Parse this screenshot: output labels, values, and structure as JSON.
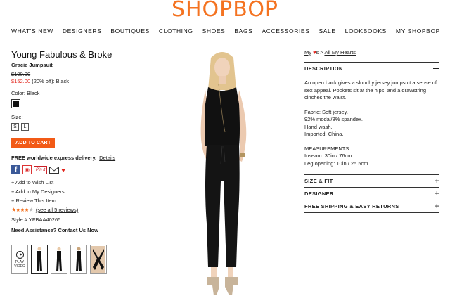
{
  "site": {
    "logo": "SHOPBOP"
  },
  "nav": [
    "WHAT'S NEW",
    "DESIGNERS",
    "BOUTIQUES",
    "CLOTHING",
    "SHOES",
    "BAGS",
    "ACCESSORIES",
    "SALE",
    "LOOKBOOKS",
    "MY SHOPBOP"
  ],
  "product": {
    "brand": "Young Fabulous & Broke",
    "name": "Gracie Jumpsuit",
    "original_price": "$190.00",
    "sale_price": "$152.00",
    "discount_text": "(20% off): Black",
    "color_label": "Color: Black",
    "swatch_color": "#111111",
    "size_label": "Size:",
    "sizes": [
      "S",
      "L"
    ],
    "add_to_cart": "ADD TO CART",
    "delivery_text": "FREE worldwide express delivery.",
    "delivery_link": "Details",
    "wish_list": "+ Add to Wish List",
    "my_designers": "+ Add to My Designers",
    "review": "+ Review This Item",
    "rating": 4,
    "rating_max": 5,
    "reviews_link": "(see all 5 reviews)",
    "style_number": "Style # YFBAA40265",
    "assist_label": "Need Assistance?",
    "assist_link": "Contact Us Now",
    "play_video": "PLAY VIDEO"
  },
  "social": {
    "pinterest": "Pin it"
  },
  "breadcrumb": {
    "my": "My",
    "suffix": "s >",
    "all": "All My Hearts"
  },
  "description": {
    "title": "DESCRIPTION",
    "intro": "An open back gives a slouchy jersey jumpsuit a sense of sex appeal. Pockets sit at the hips, and a drawstring cinches the waist.",
    "fabric": "Fabric: Soft jersey.",
    "composition": "92% modal/8% spandex.",
    "care": "Hand wash.",
    "origin": "Imported, China.",
    "measurements_title": "MEASUREMENTS",
    "inseam": "Inseam: 30in / 76cm",
    "leg_opening": "Leg opening: 10in / 25.5cm"
  },
  "accordions": [
    "SIZE & FIT",
    "DESIGNER",
    "FREE SHIPPING & EASY RETURNS"
  ]
}
